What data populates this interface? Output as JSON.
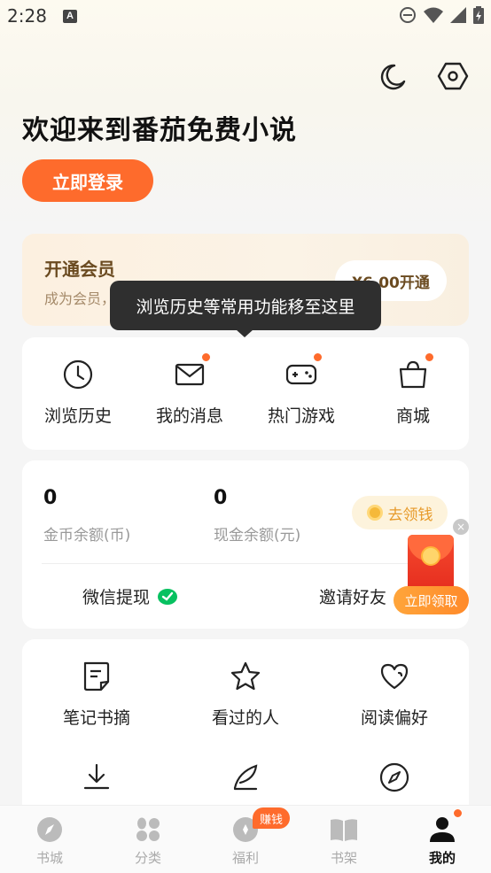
{
  "status_bar": {
    "time": "2:28",
    "notification_icon": "A"
  },
  "header": {
    "welcome_text": "欢迎来到番茄免费小说",
    "login_label": "立即登录"
  },
  "vip": {
    "title": "开通会员",
    "subtitle": "成为会员，享受免广告特权等",
    "button_label": "¥6.00开通"
  },
  "tooltip": {
    "text": "浏览历史等常用功能移至这里"
  },
  "quick_actions": [
    {
      "label": "浏览历史",
      "icon": "clock-icon",
      "badge": false
    },
    {
      "label": "我的消息",
      "icon": "mail-icon",
      "badge": true
    },
    {
      "label": "热门游戏",
      "icon": "gamepad-icon",
      "badge": true
    },
    {
      "label": "商城",
      "icon": "shopping-bag-icon",
      "badge": true
    }
  ],
  "wallet": {
    "coin_value": "0",
    "coin_label": "金币余额(币)",
    "cash_value": "0",
    "cash_label": "现金余额(元)",
    "claim_label": "去领钱",
    "wechat_withdraw": "微信提现",
    "invite_friends": "邀请好友"
  },
  "floating_packet": {
    "button_label": "立即领取",
    "close": "×"
  },
  "tools": [
    {
      "label": "笔记书摘",
      "icon": "note-icon"
    },
    {
      "label": "看过的人",
      "icon": "star-icon"
    },
    {
      "label": "阅读偏好",
      "icon": "heart-icon"
    },
    {
      "label": "",
      "icon": "download-icon"
    },
    {
      "label": "",
      "icon": "quill-icon"
    },
    {
      "label": "",
      "icon": "compass-icon"
    }
  ],
  "bottom_nav": [
    {
      "label": "书城",
      "icon": "bookstore-icon",
      "active": false
    },
    {
      "label": "分类",
      "icon": "category-icon",
      "active": false
    },
    {
      "label": "福利",
      "icon": "welfare-icon",
      "active": false,
      "badge": "赚钱"
    },
    {
      "label": "书架",
      "icon": "bookshelf-icon",
      "active": false
    },
    {
      "label": "我的",
      "icon": "profile-icon",
      "active": true
    }
  ],
  "colors": {
    "accent": "#fe6b2c",
    "tooltip_bg": "#2f2f2f",
    "vip_text": "#6a4a20",
    "wechat_green": "#07c160"
  }
}
